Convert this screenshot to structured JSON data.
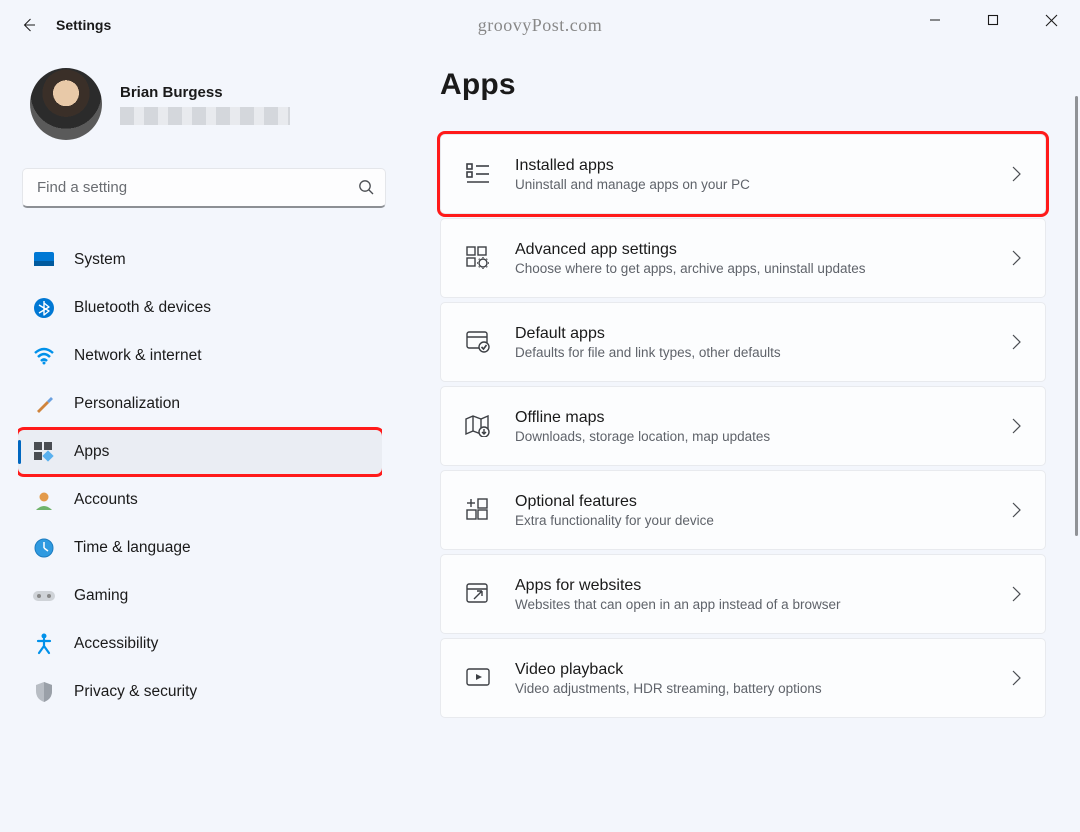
{
  "titlebar": {
    "title": "Settings",
    "watermark": "groovyPost.com"
  },
  "account": {
    "name": "Brian Burgess"
  },
  "search": {
    "placeholder": "Find a setting"
  },
  "sidebar": {
    "items": [
      {
        "id": "system",
        "label": "System"
      },
      {
        "id": "bluetooth",
        "label": "Bluetooth & devices"
      },
      {
        "id": "network",
        "label": "Network & internet"
      },
      {
        "id": "personalization",
        "label": "Personalization"
      },
      {
        "id": "apps",
        "label": "Apps",
        "selected": true
      },
      {
        "id": "accounts",
        "label": "Accounts"
      },
      {
        "id": "timelang",
        "label": "Time & language"
      },
      {
        "id": "gaming",
        "label": "Gaming"
      },
      {
        "id": "accessibility",
        "label": "Accessibility"
      },
      {
        "id": "privacy",
        "label": "Privacy & security"
      }
    ]
  },
  "page": {
    "title": "Apps",
    "cards": [
      {
        "id": "installed",
        "title": "Installed apps",
        "sub": "Uninstall and manage apps on your PC",
        "highlight": true
      },
      {
        "id": "advanced",
        "title": "Advanced app settings",
        "sub": "Choose where to get apps, archive apps, uninstall updates"
      },
      {
        "id": "default",
        "title": "Default apps",
        "sub": "Defaults for file and link types, other defaults"
      },
      {
        "id": "offlinemaps",
        "title": "Offline maps",
        "sub": "Downloads, storage location, map updates"
      },
      {
        "id": "optional",
        "title": "Optional features",
        "sub": "Extra functionality for your device"
      },
      {
        "id": "websites",
        "title": "Apps for websites",
        "sub": "Websites that can open in an app instead of a browser"
      },
      {
        "id": "video",
        "title": "Video playback",
        "sub": "Video adjustments, HDR streaming, battery options"
      }
    ]
  }
}
